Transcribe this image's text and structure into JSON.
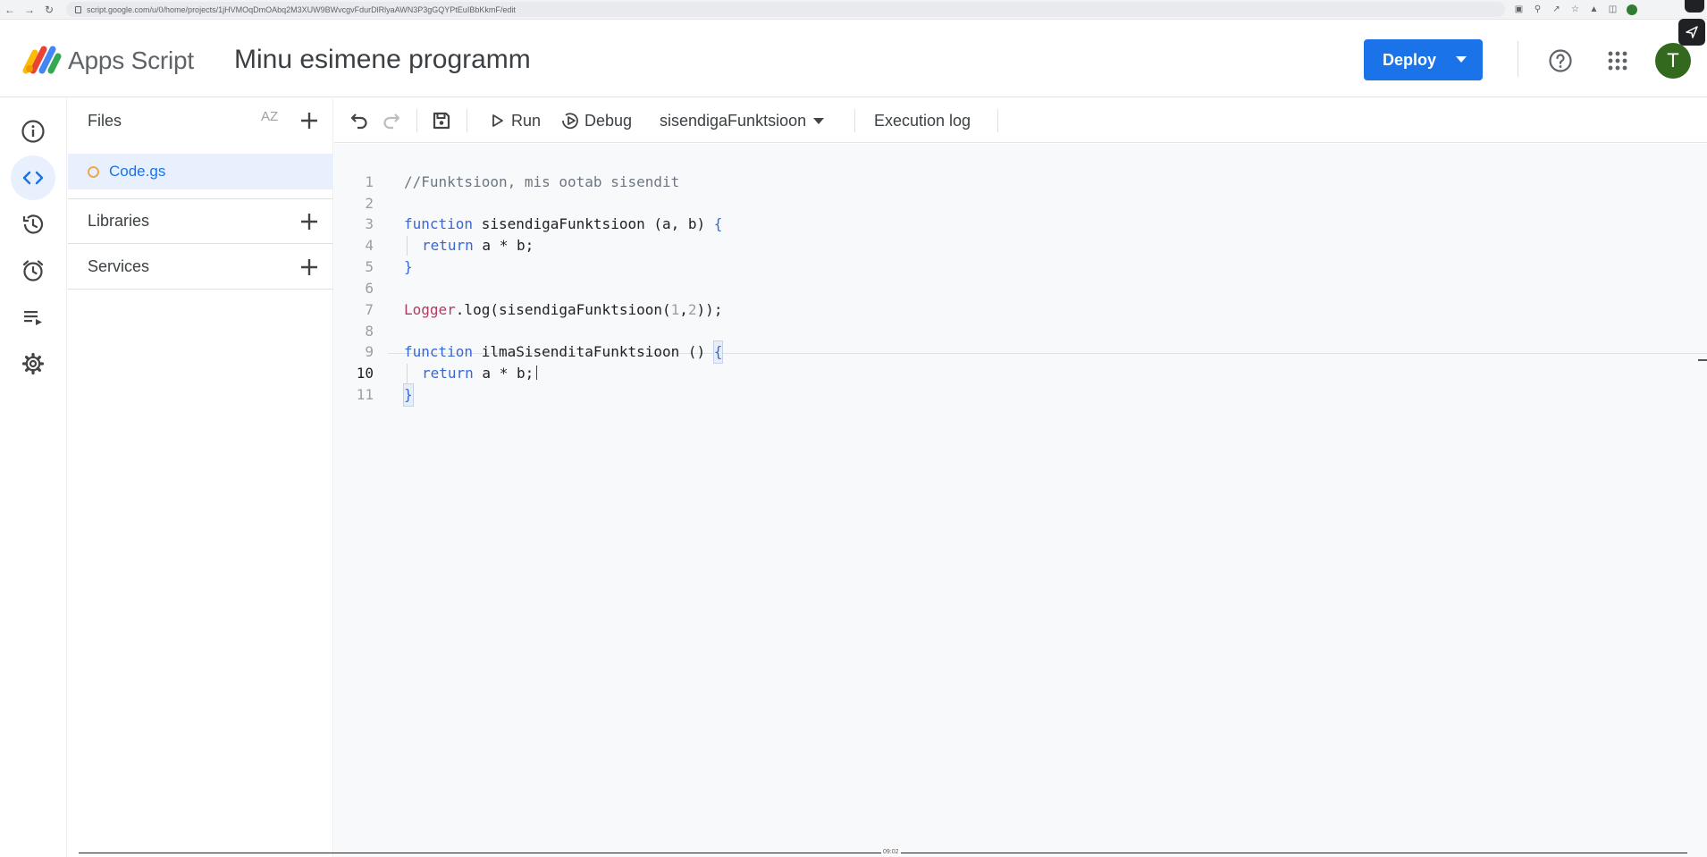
{
  "browser": {
    "url": "script.google.com/u/0/home/projects/1jHVMOqDmOAbq2M3XUW9BWvcgvFdurDlRlyaAWN3P3gGQYPtEuIBbKkmF/edit"
  },
  "header": {
    "app_name": "Apps Script",
    "project_title": "Minu esimene programm",
    "deploy_label": "Deploy",
    "avatar_letter": "T"
  },
  "rail": {
    "items": [
      {
        "name": "overview",
        "icon": "info-icon"
      },
      {
        "name": "editor",
        "icon": "code-icon",
        "active": true
      },
      {
        "name": "triggers-history",
        "icon": "history-icon"
      },
      {
        "name": "triggers",
        "icon": "alarm-clock-icon"
      },
      {
        "name": "executions",
        "icon": "executions-list-icon"
      },
      {
        "name": "settings",
        "icon": "gear-icon"
      }
    ]
  },
  "files_panel": {
    "files_title": "Files",
    "sort_label": "AZ",
    "file": "Code.gs",
    "libraries_title": "Libraries",
    "services_title": "Services"
  },
  "toolbar": {
    "run_label": "Run",
    "debug_label": "Debug",
    "function_select": "sisendigaFunktsioon",
    "execution_log_label": "Execution log"
  },
  "editor": {
    "line_numbers": [
      "1",
      "2",
      "3",
      "4",
      "5",
      "6",
      "7",
      "8",
      "9",
      "10",
      "11"
    ],
    "current_line": "10",
    "lines": {
      "l1": "//Funktsioon, mis ootab sisendit",
      "l3_kw": "function",
      "l3_rest": " sisendigaFunktsioon (a, b) ",
      "l3_brace": "{",
      "l4_kw": "return",
      "l4_rest": " a * b;",
      "l5": "}",
      "l7_cls": "Logger",
      "l7_mid": ".log(sisendigaFunktsioon(",
      "l7_n1": "1",
      "l7_comma": ",",
      "l7_n2": "2",
      "l7_end": "));",
      "l9_kw": "function",
      "l9_rest": " ilmaSisenditaFunktsioon () ",
      "l9_brace": "{",
      "l10_kw": "return",
      "l10_rest": " a * b;",
      "l11": "}"
    }
  },
  "timecode": "09:02",
  "colors": {
    "accent": "#1a73e8",
    "avatar": "#33691e",
    "keyword": "#3867d6",
    "class": "#b33b61"
  }
}
